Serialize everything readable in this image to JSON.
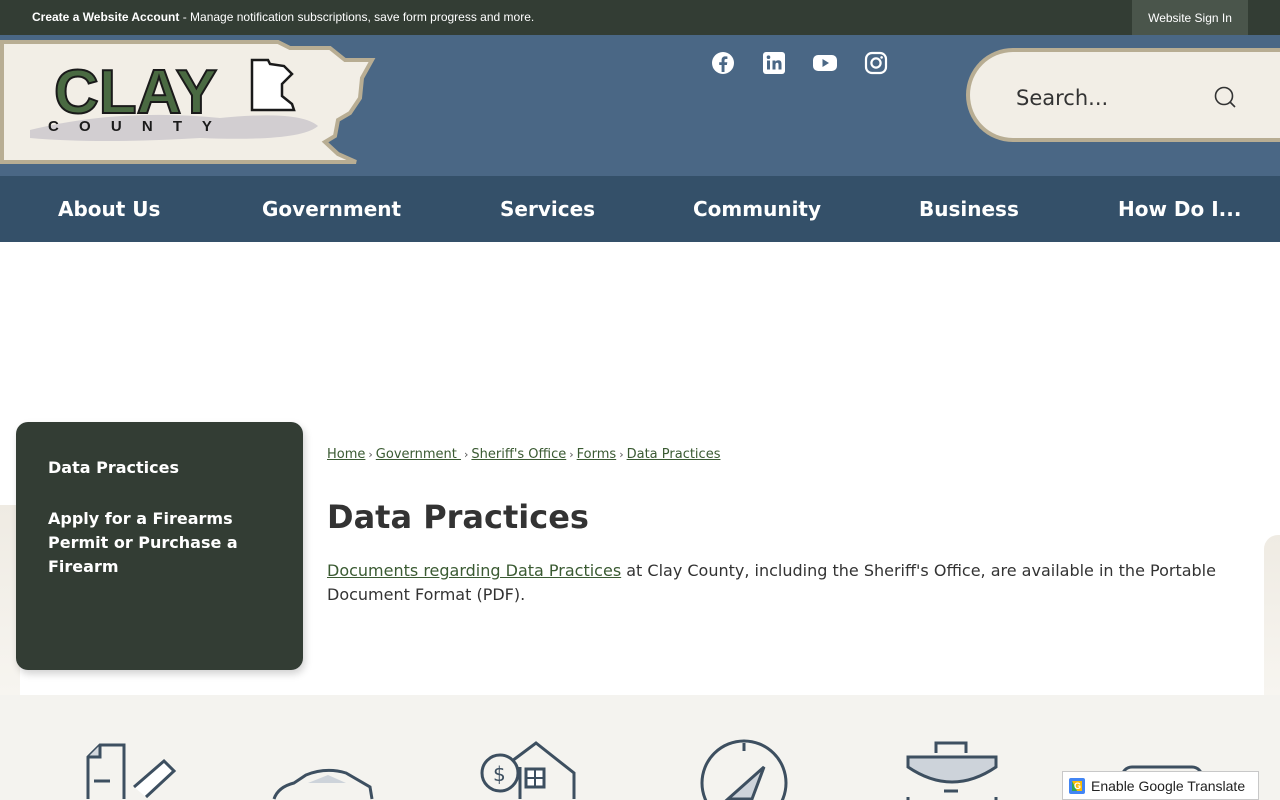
{
  "topbar": {
    "create_account": "Create a Website Account",
    "tagline": " - Manage notification subscriptions, save form progress and more.",
    "sign_in": "Website Sign In"
  },
  "logo": {
    "line1": "CLAY",
    "line2": "C O U N T Y"
  },
  "social": [
    "facebook-icon",
    "linkedin-icon",
    "youtube-icon",
    "instagram-icon"
  ],
  "search": {
    "placeholder": "Search..."
  },
  "nav": {
    "items": [
      {
        "label": "About Us"
      },
      {
        "label": "Government"
      },
      {
        "label": "Services"
      },
      {
        "label": "Community"
      },
      {
        "label": "Business"
      },
      {
        "label": "How Do I..."
      }
    ]
  },
  "sidebar": {
    "items": [
      {
        "label": "Data Practices"
      },
      {
        "label": "Apply for a Firearms Permit or Purchase a Firearm"
      }
    ]
  },
  "breadcrumb": {
    "items": [
      {
        "label": "Home"
      },
      {
        "label": "Government "
      },
      {
        "label": "Sheriff's Office"
      },
      {
        "label": "Forms"
      },
      {
        "label": "Data Practices"
      }
    ],
    "separator": "›"
  },
  "page": {
    "title": "Data Practices",
    "link_text": "Documents regarding Data Practices",
    "body": " at Clay County, including the Sheriff's Office, are available in the Portable Document Format (PDF)."
  },
  "quick_links": [
    "forms-icon",
    "vehicle-icon",
    "property-tax-icon",
    "compass-icon",
    "jobs-icon",
    "calendar-icon"
  ],
  "translate": {
    "label": "Enable Google Translate"
  },
  "colors": {
    "topbar": "#333d34",
    "header": "#4a6785",
    "nav": "#345069",
    "sidebar": "#333d34",
    "link": "#3a5a32",
    "search_bg": "#f2eee6"
  }
}
